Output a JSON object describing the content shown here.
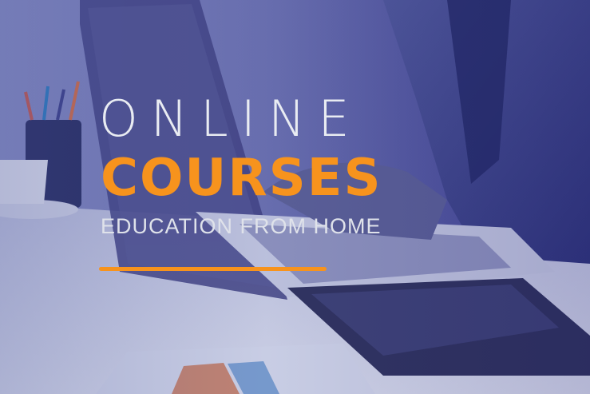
{
  "headline": {
    "line1": "ONLINE",
    "line2": "COURSES",
    "line3": "EDUCATION FROM HOME"
  },
  "colors": {
    "accent": "#f7931d",
    "text_light": "#e9ecf2",
    "overlay": "#2b3a73"
  }
}
